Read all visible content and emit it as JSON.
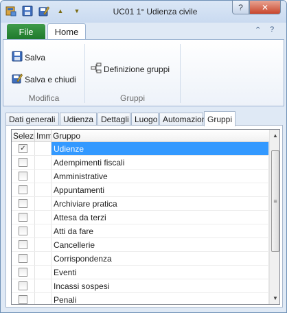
{
  "window": {
    "title": "UC01 1° Udienza civile"
  },
  "quick_access": {
    "icons": [
      "logo-icon",
      "save-icon",
      "save-close-icon",
      "arrow-up-icon",
      "arrow-down-icon"
    ],
    "up_glyph": "▲",
    "down_glyph": "▼"
  },
  "title_buttons": {
    "help": "?",
    "close": "✕"
  },
  "ribbon": {
    "tabs": {
      "file": "File",
      "home": "Home"
    },
    "minimize_glyph": "⌃",
    "help_glyph": "?",
    "groups": {
      "modifica": {
        "label": "Modifica",
        "save": "Salva",
        "save_close": "Salva e chiudi"
      },
      "gruppi": {
        "label": "Gruppi",
        "definition": "Definizione gruppi"
      }
    }
  },
  "tabs": [
    "Dati generali",
    "Udienza",
    "Dettagli",
    "Luogo",
    "Automazioni",
    "Gruppi"
  ],
  "active_tab": "Gruppi",
  "grid": {
    "columns": [
      "Selezi",
      "Imm",
      "Gruppo"
    ],
    "rows": [
      {
        "selected": true,
        "group": "Udienze"
      },
      {
        "selected": false,
        "group": "Adempimenti fiscali"
      },
      {
        "selected": false,
        "group": "Amministrative"
      },
      {
        "selected": false,
        "group": "Appuntamenti"
      },
      {
        "selected": false,
        "group": "Archiviare pratica"
      },
      {
        "selected": false,
        "group": "Attesa da terzi"
      },
      {
        "selected": false,
        "group": "Atti da fare"
      },
      {
        "selected": false,
        "group": "Cancellerie"
      },
      {
        "selected": false,
        "group": "Corrispondenza"
      },
      {
        "selected": false,
        "group": "Eventi"
      },
      {
        "selected": false,
        "group": "Incassi sospesi"
      },
      {
        "selected": false,
        "group": "Penali"
      }
    ],
    "check_glyph": "✓",
    "scroll": {
      "up_glyph": "▲",
      "down_glyph": "▼",
      "grip_glyph": "≡"
    }
  },
  "colors": {
    "selection": "#3399ff",
    "file_tab": "#2a8a37",
    "close_button": "#c9462c"
  }
}
